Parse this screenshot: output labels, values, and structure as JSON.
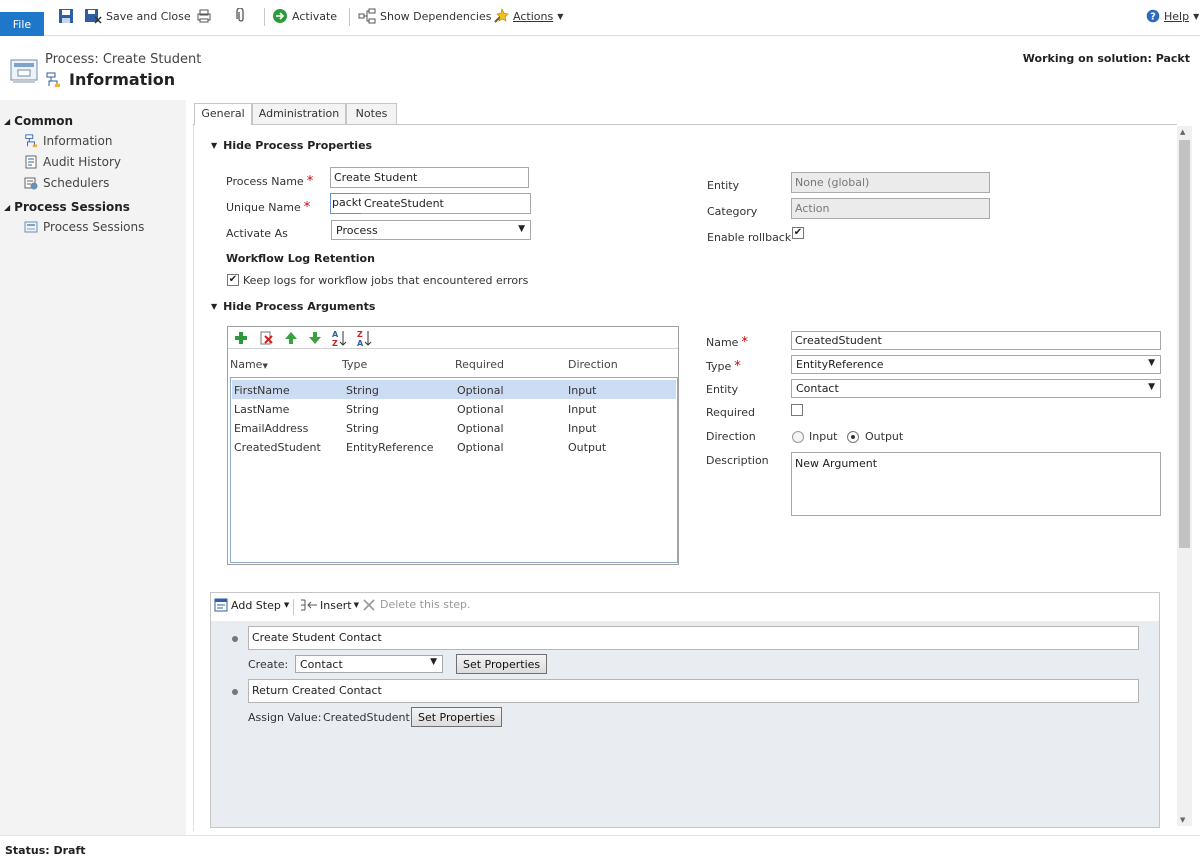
{
  "ribbon": {
    "file": "File",
    "save_and_close": "Save and Close",
    "activate": "Activate",
    "show_dependencies": "Show Dependencies",
    "actions": "Actions",
    "help": "Help"
  },
  "header": {
    "breadcrumb": "Process: Create Student",
    "title": "Information",
    "solution": "Working on solution: Packt"
  },
  "nav": {
    "common": "Common",
    "items_common": [
      "Information",
      "Audit History",
      "Schedulers"
    ],
    "sessions": "Process Sessions",
    "items_sessions": [
      "Process Sessions"
    ]
  },
  "tabs": [
    "General",
    "Administration",
    "Notes"
  ],
  "properties": {
    "section_title": "Hide Process Properties",
    "process_name_label": "Process Name",
    "process_name_value": "Create Student",
    "unique_name_label": "Unique Name",
    "unique_prefix": "packt_",
    "unique_value": "CreateStudent",
    "activate_as_label": "Activate As",
    "activate_as_value": "Process",
    "log_retention_title": "Workflow Log Retention",
    "keep_logs_label": "Keep logs for workflow jobs that encountered errors",
    "keep_logs_checked": true,
    "entity_label": "Entity",
    "entity_value": "None (global)",
    "category_label": "Category",
    "category_value": "Action",
    "enable_rollback_label": "Enable rollback",
    "enable_rollback_checked": true
  },
  "arguments": {
    "section_title": "Hide Process Arguments",
    "columns": [
      "Name",
      "Type",
      "Required",
      "Direction"
    ],
    "rows": [
      {
        "name": "FirstName",
        "type": "String",
        "required": "Optional",
        "direction": "Input"
      },
      {
        "name": "LastName",
        "type": "String",
        "required": "Optional",
        "direction": "Input"
      },
      {
        "name": "EmailAddress",
        "type": "String",
        "required": "Optional",
        "direction": "Input"
      },
      {
        "name": "CreatedStudent",
        "type": "EntityReference",
        "required": "Optional",
        "direction": "Output"
      }
    ],
    "selected_row": 0,
    "detail": {
      "name_label": "Name",
      "name_value": "CreatedStudent",
      "type_label": "Type",
      "type_value": "EntityReference",
      "entity_label": "Entity",
      "entity_value": "Contact",
      "required_label": "Required",
      "required_checked": false,
      "direction_label": "Direction",
      "direction_input": "Input",
      "direction_output": "Output",
      "direction_selected": "Output",
      "description_label": "Description",
      "description_value": "New Argument"
    }
  },
  "steps": {
    "add_step": "Add Step",
    "insert": "Insert",
    "delete": "Delete this step.",
    "step1_desc": "Create Student Contact",
    "step1_create_label": "Create:",
    "step1_create_value": "Contact",
    "step1_button": "Set Properties",
    "step2_desc": "Return Created Contact",
    "step2_assign_label": "Assign Value:",
    "step2_assign_value": "CreatedStudent",
    "step2_button": "Set Properties"
  },
  "status": "Status: Draft"
}
